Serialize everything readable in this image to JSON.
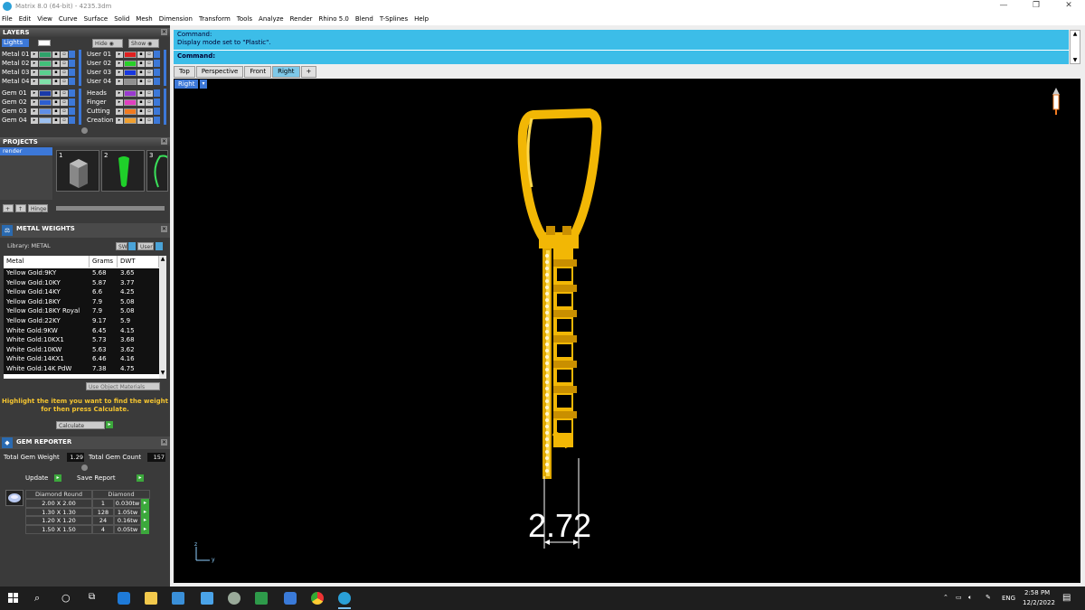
{
  "window": {
    "title": "Matrix 8.0 (64-bit) - 4235.3dm",
    "minimize": "—",
    "restore": "❐",
    "close": "✕"
  },
  "menu": [
    "File",
    "Edit",
    "View",
    "Curve",
    "Surface",
    "Solid",
    "Mesh",
    "Dimension",
    "Transform",
    "Tools",
    "Analyze",
    "Render",
    "Rhino 5.0",
    "Blend",
    "T-Splines",
    "Help"
  ],
  "layers": {
    "title": "LAYERS",
    "lights_label": "Lights",
    "hide_label": "Hide",
    "show_label": "Show",
    "left": [
      {
        "name": "Metal 01",
        "color": "#2ea36a"
      },
      {
        "name": "Metal 02",
        "color": "#42c07a"
      },
      {
        "name": "Metal 03",
        "color": "#5ad08e"
      },
      {
        "name": "Metal 04",
        "color": "#7ee0a8"
      },
      {
        "name": "Gem 01",
        "color": "#1a3aa8"
      },
      {
        "name": "Gem 02",
        "color": "#2c5ed0"
      },
      {
        "name": "Gem 03",
        "color": "#5f8ee6"
      },
      {
        "name": "Gem 04",
        "color": "#9cc0f0"
      }
    ],
    "right": [
      {
        "name": "User 01",
        "color": "#e02020"
      },
      {
        "name": "User 02",
        "color": "#28d028"
      },
      {
        "name": "User 03",
        "color": "#1838e0"
      },
      {
        "name": "User 04",
        "color": "#909090"
      },
      {
        "name": "Heads",
        "color": "#9a3ad0"
      },
      {
        "name": "Finger",
        "color": "#e040c0"
      },
      {
        "name": "Cutting",
        "color": "#f07a20"
      },
      {
        "name": "Creation",
        "color": "#f0a030"
      }
    ]
  },
  "projects": {
    "title": "PROJECTS",
    "items": [
      "render"
    ],
    "thumbs": [
      "1",
      "2",
      "3"
    ],
    "hinge_label": "Hinge"
  },
  "metal_weights": {
    "title": "METAL WEIGHTS",
    "library": "Library: METAL",
    "sw_label": "SW",
    "user_label": "User",
    "headers": [
      "Metal",
      "Grams",
      "DWT"
    ],
    "rows": [
      [
        "Yellow Gold:9KY",
        "5.68",
        "3.65"
      ],
      [
        "Yellow Gold:10KY",
        "5.87",
        "3.77"
      ],
      [
        "Yellow Gold:14KY",
        "6.6",
        "4.25"
      ],
      [
        "Yellow Gold:18KY",
        "7.9",
        "5.08"
      ],
      [
        "Yellow Gold:18KY Royal",
        "7.9",
        "5.08"
      ],
      [
        "Yellow Gold:22KY",
        "9.17",
        "5.9"
      ],
      [
        "White Gold:9KW",
        "6.45",
        "4.15"
      ],
      [
        "White Gold:10KX1",
        "5.73",
        "3.68"
      ],
      [
        "White Gold:10KW",
        "5.63",
        "3.62"
      ],
      [
        "White Gold:14KX1",
        "6.46",
        "4.16"
      ],
      [
        "White Gold:14K PdW",
        "7.38",
        "4.75"
      ]
    ],
    "use_object_materials": "Use Object Materials",
    "hint_line1": "Highlight the item you want to find the weight",
    "hint_line2": "for then press Calculate.",
    "calculate_label": "Calculate"
  },
  "gem_reporter": {
    "title": "GEM REPORTER",
    "total_weight_label": "Total Gem Weight",
    "total_weight_value": "1.29",
    "total_count_label": "Total Gem Count",
    "total_count_value": "157",
    "update_label": "Update",
    "save_label": "Save Report",
    "headers": [
      "Diamond Round",
      "Diamond"
    ],
    "rows": [
      [
        "2.00 X 2.00",
        "1",
        "0.030tw"
      ],
      [
        "1.30 X 1.30",
        "128",
        "1.05tw"
      ],
      [
        "1.20 X 1.20",
        "24",
        "0.16tw"
      ],
      [
        "1.50 X 1.50",
        "4",
        "0.05tw"
      ]
    ]
  },
  "command": {
    "line1": "Command:",
    "line2": "Display mode set to \"Plastic\".",
    "prompt": "Command:"
  },
  "viewport_tabs": [
    "Top",
    "Perspective",
    "Front",
    "Right",
    "+"
  ],
  "active_tab": "Right",
  "viewport_label": "Right",
  "dimension_value": "2.72",
  "axis": {
    "z": "z",
    "y": "y"
  },
  "taskbar": {
    "lang": "ENG",
    "time": "2:58 PM",
    "date": "12/2/2022"
  },
  "colors": {
    "gold": "#f2b705",
    "gold_dark": "#b07800",
    "cyan": "#3cbde8"
  }
}
